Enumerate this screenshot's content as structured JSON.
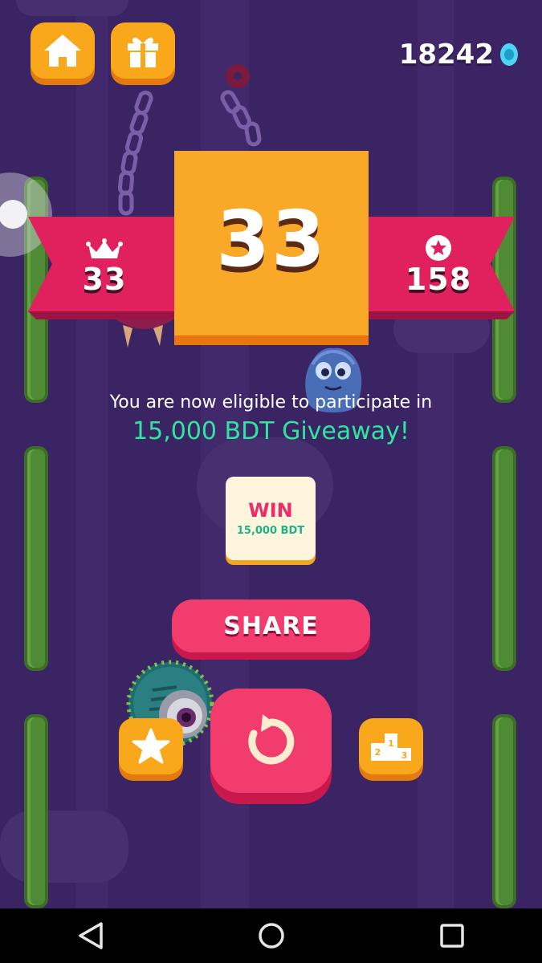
{
  "hud": {
    "coins": "18242",
    "home_icon": "home-icon",
    "gift_icon": "gift-icon",
    "gem_icon": "gem-icon"
  },
  "results": {
    "score": "33",
    "best_score": "33",
    "stars": "158",
    "best_icon": "crown-icon",
    "stars_icon": "star-icon"
  },
  "message": {
    "line1": "You are now eligible to participate in",
    "line2": "15,000 BDT Giveaway!"
  },
  "win_card": {
    "title": "WIN",
    "subtitle": "15,000 BDT"
  },
  "buttons": {
    "share": "SHARE",
    "replay_icon": "replay-icon",
    "rate_icon": "star-icon",
    "leaderboard_icon": "podium-icon"
  },
  "navbar": {
    "back_icon": "back-icon",
    "home_icon": "circle-home-icon",
    "recents_icon": "recents-icon"
  },
  "colors": {
    "background": "#3b2463",
    "accent_orange": "#f9a81c",
    "accent_pink": "#f23c6e",
    "ribbon": "#e0215e",
    "giveaway_text": "#2ee6a0"
  }
}
